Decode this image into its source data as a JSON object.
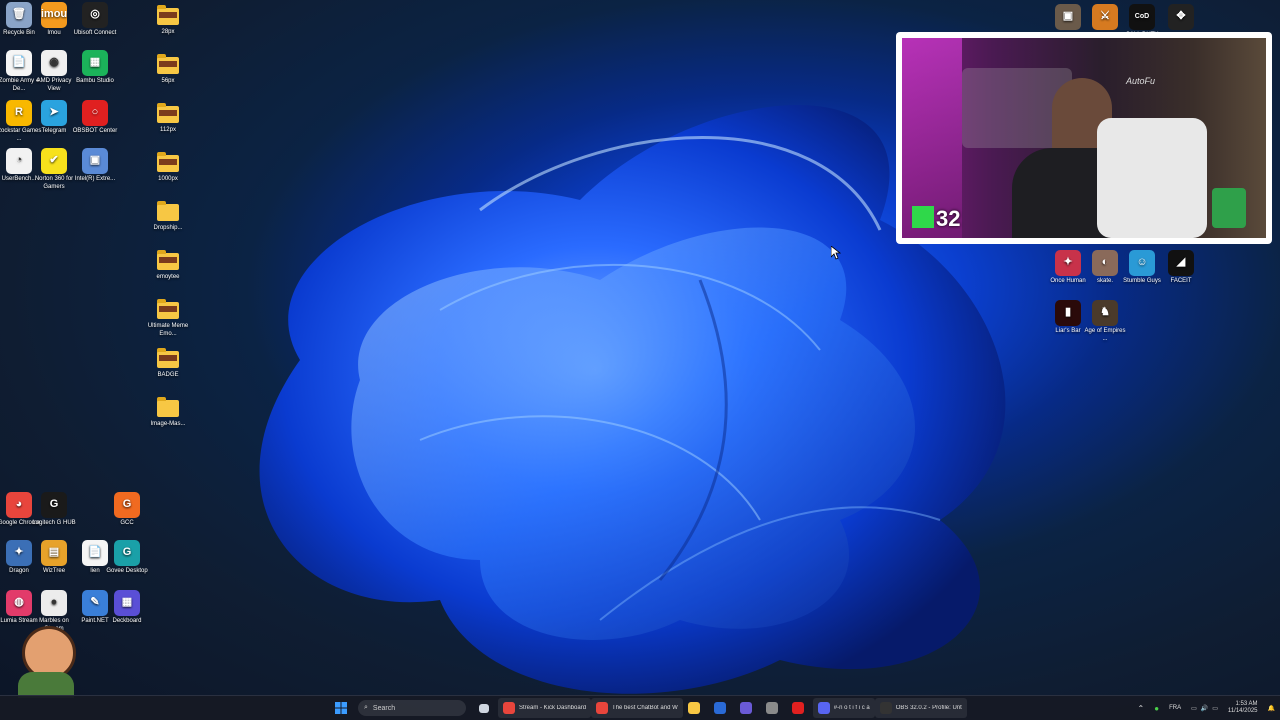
{
  "desktop": {
    "left_icons": [
      {
        "label": "Recycle Bin",
        "icon": "recycle-bin-icon",
        "color": "#8aa4c8",
        "glyph": "🗑"
      },
      {
        "label": "Imou",
        "icon": "imou-icon",
        "color": "#f49a1e",
        "glyph": "imou"
      },
      {
        "label": "Ubisoft Connect",
        "icon": "ubisoft-icon",
        "color": "#222",
        "glyph": "◎"
      },
      {
        "label": "Zombie Army 4 De...",
        "icon": "zombie-army-icon",
        "color": "#f5f5f5",
        "glyph": "📄"
      },
      {
        "label": "AMD Privacy View",
        "icon": "amd-privacy-icon",
        "color": "#f0f0f0",
        "glyph": "◉"
      },
      {
        "label": "Bambu Studio",
        "icon": "bambu-icon",
        "color": "#1bb35a",
        "glyph": "▦"
      },
      {
        "label": "Rockstar Games ...",
        "icon": "rockstar-icon",
        "color": "#f9b800",
        "glyph": "R"
      },
      {
        "label": "Telegram",
        "icon": "telegram-icon",
        "color": "#2aa3df",
        "glyph": "➤"
      },
      {
        "label": "OBSBOT Center",
        "icon": "obsbot-icon",
        "color": "#e02020",
        "glyph": "○"
      },
      {
        "label": "UserBench...",
        "icon": "userbench-icon",
        "color": "#f2f2f2",
        "glyph": "◔"
      },
      {
        "label": "Norton 360 for Gamers",
        "icon": "norton-icon",
        "color": "#f7e11c",
        "glyph": "✔"
      },
      {
        "label": "Intel(R) Extre...",
        "icon": "intel-icon",
        "color": "#5a8ad6",
        "glyph": "▣"
      },
      {
        "label": "Google Chrome",
        "icon": "chrome-icon",
        "color": "#e8453c",
        "glyph": "◕"
      },
      {
        "label": "Logitech G HUB",
        "icon": "logitech-icon",
        "color": "#1a1a1a",
        "glyph": "G"
      },
      {
        "label": "GCC",
        "icon": "gcc-icon",
        "color": "#f06a20",
        "glyph": "G"
      },
      {
        "label": "Dragon",
        "icon": "dragon-icon",
        "color": "#3b6fb6",
        "glyph": "✦"
      },
      {
        "label": "WizTree",
        "icon": "wiztree-icon",
        "color": "#e7a22a",
        "glyph": "▤"
      },
      {
        "label": "lien",
        "icon": "lien-icon",
        "color": "#f5f5f5",
        "glyph": "📄"
      },
      {
        "label": "Govee Desktop",
        "icon": "govee-icon",
        "color": "#1aa0a8",
        "glyph": "G"
      },
      {
        "label": "Lumia Stream",
        "icon": "lumia-icon",
        "color": "#e23b6a",
        "glyph": "◍"
      },
      {
        "label": "Marbles on Stream",
        "icon": "marbles-icon",
        "color": "#ececec",
        "glyph": "●"
      },
      {
        "label": "Paint.NET",
        "icon": "paintnet-icon",
        "color": "#3a7fd8",
        "glyph": "✎"
      },
      {
        "label": "Deckboard",
        "icon": "deckboard-icon",
        "color": "#5a4fd6",
        "glyph": "▦"
      }
    ],
    "folders": [
      {
        "label": "28px"
      },
      {
        "label": "56px"
      },
      {
        "label": "112px"
      },
      {
        "label": "1000px"
      },
      {
        "label": "Dropship..."
      },
      {
        "label": "emoytee"
      },
      {
        "label": "Ultimate Meme Emo..."
      },
      {
        "label": "BADGE"
      },
      {
        "label": "Image-Mas..."
      }
    ],
    "right_icons": [
      {
        "label": "",
        "icon": "game-icon-1",
        "color": "#6a5a4a",
        "glyph": "▣"
      },
      {
        "label": "",
        "icon": "game-icon-2",
        "color": "#d67a20",
        "glyph": "⚔"
      },
      {
        "label": "CALL DUTY",
        "icon": "call-of-duty-icon",
        "color": "#111",
        "glyph": "CoD"
      },
      {
        "label": "",
        "icon": "game-icon-4",
        "color": "#222",
        "glyph": "✥"
      },
      {
        "label": "Once Human",
        "icon": "once-human-icon",
        "color": "#c8324a",
        "glyph": "✦"
      },
      {
        "label": "skate.",
        "icon": "skate-icon",
        "color": "#8a6a5a",
        "glyph": "◐"
      },
      {
        "label": "Stumble Guys",
        "icon": "stumble-guys-icon",
        "color": "#2a9ad6",
        "glyph": "☺"
      },
      {
        "label": "FACEIT",
        "icon": "faceit-icon",
        "color": "#111",
        "glyph": "◢"
      },
      {
        "label": "Liar's Bar",
        "icon": "liars-bar-icon",
        "color": "#2a0a0a",
        "glyph": "▮"
      },
      {
        "label": "Age of Empires ...",
        "icon": "age-of-empires-icon",
        "color": "#4a3a2a",
        "glyph": "♞"
      }
    ]
  },
  "webcam": {
    "overlay_number": "32",
    "shirt_text": "AutoFu"
  },
  "taskbar": {
    "search_placeholder": "Search",
    "apps": [
      {
        "label": "Stream - Kick Dashboard",
        "icon": "chrome-icon",
        "color": "#e8453c"
      },
      {
        "label": "The best ChatBot and W",
        "icon": "chrome-icon",
        "color": "#e8453c"
      },
      {
        "label": "",
        "icon": "file-explorer-icon",
        "color": "#f7c744"
      },
      {
        "label": "",
        "icon": "store-icon",
        "color": "#2a6ad6"
      },
      {
        "label": "",
        "icon": "teams-icon",
        "color": "#6a5ad6"
      },
      {
        "label": "",
        "icon": "settings-icon",
        "color": "#8a8a8a"
      },
      {
        "label": "",
        "icon": "opera-icon",
        "color": "#e02020"
      },
      {
        "label": "#-n o t i f i c a",
        "icon": "discord-icon",
        "color": "#5865f2"
      },
      {
        "label": "OBS 32.0.2 - Profile: Unt",
        "icon": "obs-icon",
        "color": "#333"
      }
    ],
    "tray": {
      "language": "FRA",
      "time": "1:53 AM",
      "date": "11/14/2025"
    }
  }
}
